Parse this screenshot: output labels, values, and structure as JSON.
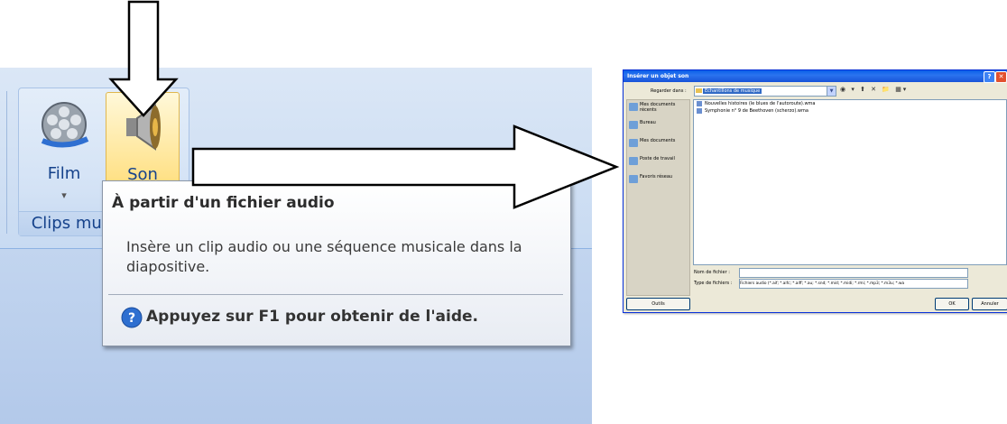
{
  "ribbon": {
    "film_label": "Film",
    "son_label": "Son",
    "group_label": "Clips multimédias",
    "caret": "▾"
  },
  "tooltip": {
    "title": "À partir d'un fichier audio",
    "description": "Insère un clip audio ou une séquence musicale dans la diapositive.",
    "help": "Appuyez sur F1 pour obtenir de l'aide."
  },
  "dialog": {
    "title": "Insérer un objet son",
    "help_btn": "?",
    "close_btn": "✕",
    "look_in_label": "Regarder dans :",
    "look_in_value": "Échantillons de musique",
    "toolbar_glyphs": "◉ ▾ ⬆ ✕ 📁 ▦▾",
    "places": [
      "Mes documents récents",
      "Bureau",
      "Mes documents",
      "Poste de travail",
      "Favoris réseau"
    ],
    "files": [
      "Nouvelles histoires (le blues de l'autoroute).wma",
      "Symphonie n° 9 de Beethoven (scherzo).wma"
    ],
    "filename_label": "Nom de fichier :",
    "filetype_label": "Type de fichiers :",
    "filetype_value": "Fichiers audio (*.aif; *.aifc; *.aiff; *.au; *.snd; *.mid; *.midi; *.rmi; *.mp3; *.m3u; *.wa",
    "outils_label": "Outils",
    "ok_label": "OK",
    "cancel_label": "Annuler"
  },
  "colors": {
    "ribbon_text": "#15428b",
    "son_highlight": "#ffd867",
    "titlebar": "#0a5fe8"
  }
}
